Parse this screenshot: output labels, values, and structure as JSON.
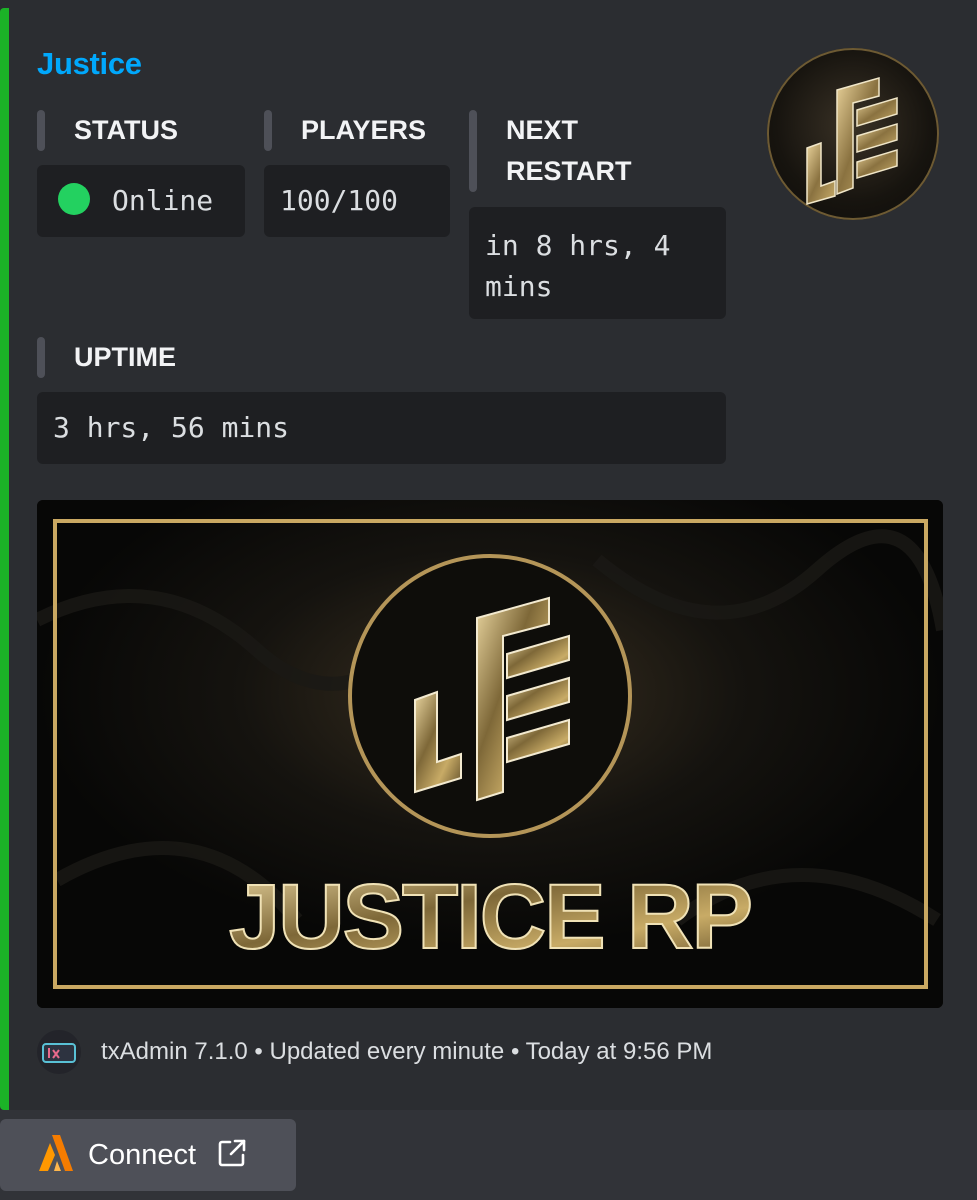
{
  "embed": {
    "accent_color": "#1bb327",
    "title": "Justice",
    "fields": {
      "status": {
        "name": "STATUS",
        "value": "Online",
        "dot_color": "#23d160"
      },
      "players": {
        "name": "PLAYERS",
        "value": "100/100"
      },
      "next_restart": {
        "name_line1": "NEXT",
        "name_line2": "RESTART",
        "value_line1": "in 8 hrs, 4",
        "value_line2": "mins"
      },
      "uptime": {
        "name": "UPTIME",
        "value": "3 hrs, 56 mins"
      }
    },
    "banner": {
      "text": "JUSTICE RP"
    },
    "footer": {
      "text": "txAdmin 7.1.0 • Updated every minute • Today at 9:56 PM"
    }
  },
  "connect_button": {
    "label": "Connect",
    "icon": "external-link-icon",
    "brand_icon": "fivem-logo-icon"
  }
}
